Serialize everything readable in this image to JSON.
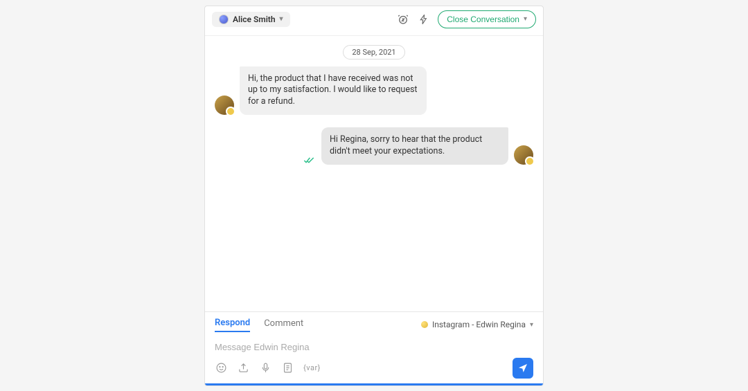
{
  "header": {
    "assignee_name": "Alice Smith",
    "close_label": "Close Conversation"
  },
  "conversation": {
    "date_label": "28 Sep, 2021",
    "messages": [
      {
        "direction": "in",
        "text": "Hi, the product that I have received was not up to my satisfaction. I would like to request for a refund."
      },
      {
        "direction": "out",
        "text": "Hi Regina, sorry to hear that the product didn't meet your expectations."
      }
    ]
  },
  "composer": {
    "tabs": {
      "respond": "Respond",
      "comment": "Comment"
    },
    "channel_label": "Instagram - Edwin Regina",
    "placeholder": "Message Edwin Regina",
    "var_token": "{var}"
  }
}
